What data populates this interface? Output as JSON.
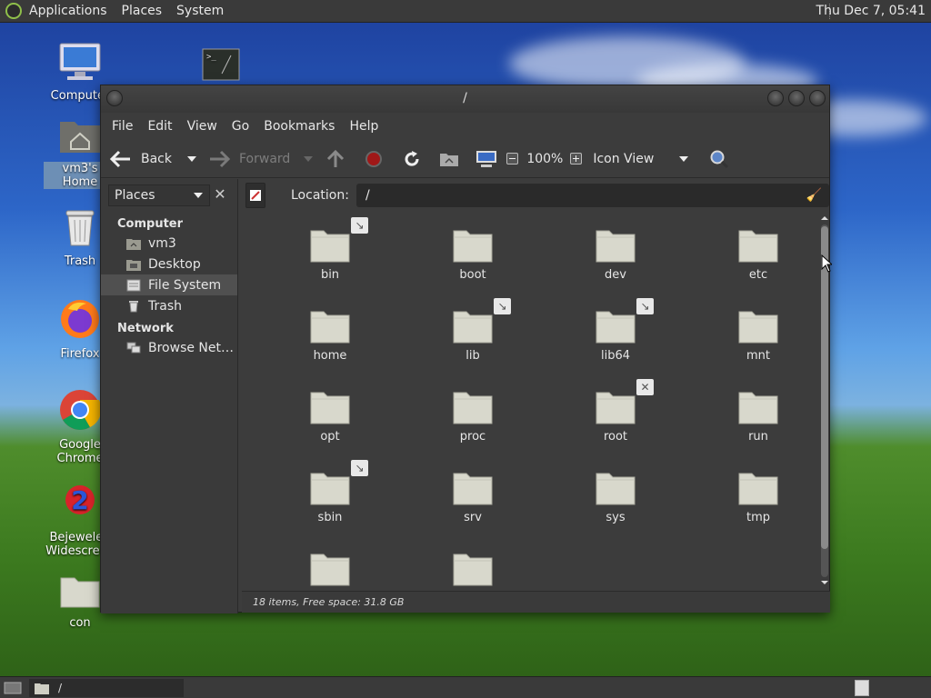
{
  "top_panel": {
    "menus": [
      "Applications",
      "Places",
      "System"
    ],
    "clock": "Thu Dec  7, 05:41"
  },
  "desktop_icons": [
    {
      "label": "Computer",
      "icon": "computer-icon"
    },
    {
      "label": "vm3's Home",
      "icon": "home-folder-icon"
    },
    {
      "label": "Trash",
      "icon": "trash-icon"
    },
    {
      "label": "Firefox",
      "icon": "firefox-icon"
    },
    {
      "label": "Google Chrome",
      "icon": "chrome-icon"
    },
    {
      "label": "Bejeweled Widescreen",
      "icon": "bejeweled-icon"
    },
    {
      "label": "con",
      "icon": "folder-icon"
    },
    {
      "label": "",
      "icon": "terminal-icon"
    }
  ],
  "window": {
    "title": "/",
    "menubar": [
      "File",
      "Edit",
      "View",
      "Go",
      "Bookmarks",
      "Help"
    ],
    "toolbar": {
      "back": "Back",
      "forward": "Forward",
      "zoom": "100%",
      "view_mode": "Icon View"
    },
    "sidebar": {
      "combo": "Places",
      "groups": [
        {
          "title": "Computer",
          "items": [
            {
              "label": "vm3",
              "icon": "home-icon"
            },
            {
              "label": "Desktop",
              "icon": "desktop-icon"
            },
            {
              "label": "File System",
              "icon": "drive-icon",
              "active": true
            },
            {
              "label": "Trash",
              "icon": "trash-icon"
            }
          ]
        },
        {
          "title": "Network",
          "items": [
            {
              "label": "Browse Net…",
              "icon": "network-icon"
            }
          ]
        }
      ]
    },
    "location": {
      "label": "Location:",
      "value": "/"
    },
    "items": [
      {
        "name": "bin",
        "emblem": "link"
      },
      {
        "name": "boot",
        "emblem": ""
      },
      {
        "name": "dev",
        "emblem": ""
      },
      {
        "name": "etc",
        "emblem": ""
      },
      {
        "name": "home",
        "emblem": ""
      },
      {
        "name": "lib",
        "emblem": "link"
      },
      {
        "name": "lib64",
        "emblem": "link"
      },
      {
        "name": "mnt",
        "emblem": ""
      },
      {
        "name": "opt",
        "emblem": ""
      },
      {
        "name": "proc",
        "emblem": ""
      },
      {
        "name": "root",
        "emblem": "locked"
      },
      {
        "name": "run",
        "emblem": ""
      },
      {
        "name": "sbin",
        "emblem": "link"
      },
      {
        "name": "srv",
        "emblem": ""
      },
      {
        "name": "sys",
        "emblem": ""
      },
      {
        "name": "tmp",
        "emblem": ""
      },
      {
        "name": "",
        "emblem": ""
      },
      {
        "name": "",
        "emblem": ""
      }
    ],
    "status": "18 items, Free space: 31.8 GB"
  },
  "bottom_panel": {
    "task_label": "/"
  },
  "colors": {
    "panel": "#3a3a3a",
    "window_bg": "#3c3c3c",
    "folder": "#d8d8cc",
    "accent_red": "#a01818"
  }
}
